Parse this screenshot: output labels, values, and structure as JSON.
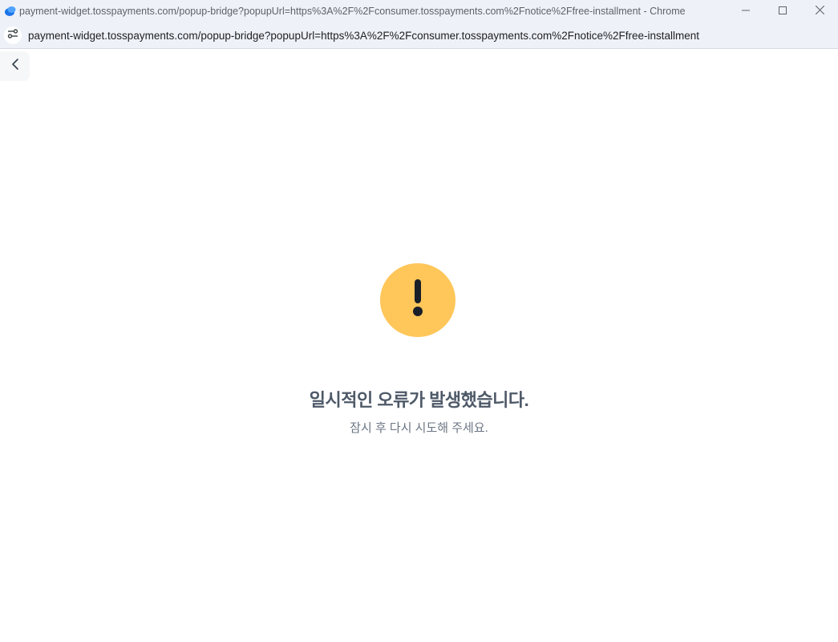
{
  "window": {
    "title": "payment-widget.tosspayments.com/popup-bridge?popupUrl=https%3A%2F%2Fconsumer.tosspayments.com%2Fnotice%2Ffree-installment - Chrome",
    "app_icon": "chrome-app-icon",
    "controls": [
      "minimize-icon",
      "maximize-icon",
      "close-icon"
    ]
  },
  "addressbar": {
    "url": "payment-widget.tosspayments.com/popup-bridge?popupUrl=https%3A%2F%2Fconsumer.tosspayments.com%2Fnotice%2Ffree-installment",
    "site_info_icon": "tune-icon"
  },
  "page": {
    "back_icon": "chevron-left-icon",
    "alert_icon": "exclamation-icon",
    "error_title": "일시적인 오류가 발생했습니다.",
    "error_subtitle": "잠시 후 다시 시도해 주세요."
  },
  "colors": {
    "alert_yellow": "#ffc65a",
    "title_text": "#4e5968",
    "subtitle_text": "#6b7684",
    "chrome_bar": "#eef1f8"
  }
}
